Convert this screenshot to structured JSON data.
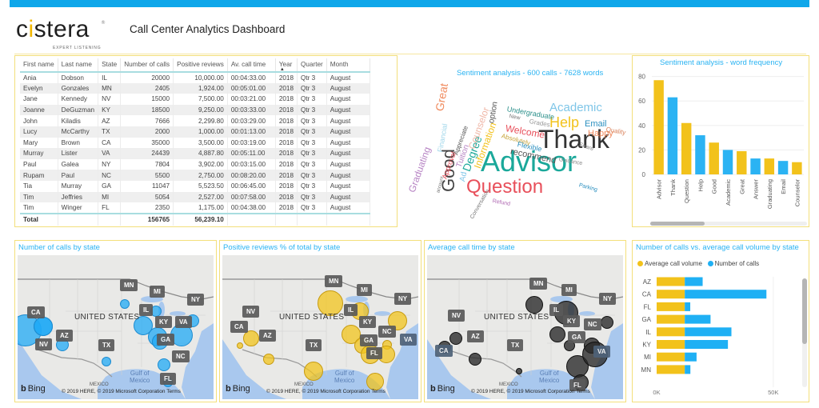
{
  "header": {
    "logo_text": "cistera",
    "logo_tagline": "EXPERT LISTENING",
    "logo_reg": "®",
    "title": "Call Center Analytics Dashboard"
  },
  "colors": {
    "accent_blue": "#0fa7ea",
    "bar_yellow": "#f2c21b",
    "bar_blue": "#2bb3f3",
    "panel_border": "#f3df7b",
    "title_blue": "#2ab3f2"
  },
  "table": {
    "columns": [
      "First name",
      "Last name",
      "State",
      "Number of calls",
      "Positive reviews",
      "Av. call time",
      "Year",
      "Quarter",
      "Month"
    ],
    "sorted_column": "Year",
    "sort_indicator": "▲",
    "rows": [
      [
        "Ania",
        "Dobson",
        "IL",
        "20000",
        "10,000.00",
        "00:04:33.00",
        "2018",
        "Qtr 3",
        "August"
      ],
      [
        "Evelyn",
        "Gonzales",
        "MN",
        "2405",
        "1,924.00",
        "00:05:01.00",
        "2018",
        "Qtr 3",
        "August"
      ],
      [
        "Jane",
        "Kennedy",
        "NV",
        "15000",
        "7,500.00",
        "00:03:21.00",
        "2018",
        "Qtr 3",
        "August"
      ],
      [
        "Joanne",
        "DeGuzman",
        "KY",
        "18500",
        "9,250.00",
        "00:03:33.00",
        "2018",
        "Qtr 3",
        "August"
      ],
      [
        "John",
        "Kiladis",
        "AZ",
        "7666",
        "2,299.80",
        "00:03:29.00",
        "2018",
        "Qtr 3",
        "August"
      ],
      [
        "Lucy",
        "McCarthy",
        "TX",
        "2000",
        "1,000.00",
        "00:01:13.00",
        "2018",
        "Qtr 3",
        "August"
      ],
      [
        "Mary",
        "Brown",
        "CA",
        "35000",
        "3,500.00",
        "00:03:19.00",
        "2018",
        "Qtr 3",
        "August"
      ],
      [
        "Murray",
        "Lister",
        "VA",
        "24439",
        "4,887.80",
        "00:05:11.00",
        "2018",
        "Qtr 3",
        "August"
      ],
      [
        "Paul",
        "Galea",
        "NY",
        "7804",
        "3,902.00",
        "00:03:15.00",
        "2018",
        "Qtr 3",
        "August"
      ],
      [
        "Rupam",
        "Paul",
        "NC",
        "5500",
        "2,750.00",
        "00:08:20.00",
        "2018",
        "Qtr 3",
        "August"
      ],
      [
        "Tia",
        "Murray",
        "GA",
        "11047",
        "5,523.50",
        "00:06:45.00",
        "2018",
        "Qtr 3",
        "August"
      ],
      [
        "Tim",
        "Jeffries",
        "MI",
        "5054",
        "2,527.00",
        "00:07:58.00",
        "2018",
        "Qtr 3",
        "August"
      ],
      [
        "Tim",
        "Winger",
        "FL",
        "2350",
        "1,175.00",
        "00:04:38.00",
        "2018",
        "Qtr 3",
        "August"
      ]
    ],
    "total": [
      "Total",
      "",
      "",
      "156765",
      "56,239.10",
      "",
      "",
      "",
      ""
    ]
  },
  "wordcloud": {
    "title": "Sentiment analysis - 600 calls - 7628 words",
    "words": [
      {
        "text": "Advisor",
        "color": "#1aa89a"
      },
      {
        "text": "Thank",
        "color": "#333333"
      },
      {
        "text": "Question",
        "color": "#e8505b"
      },
      {
        "text": "Help",
        "color": "#f2c21b"
      },
      {
        "text": "Academic",
        "color": "#7fc6e8"
      },
      {
        "text": "Good",
        "color": "#444444"
      },
      {
        "text": "Great",
        "color": "#f08a5d"
      },
      {
        "text": "Graduating",
        "color": "#b784c4"
      },
      {
        "text": "Email",
        "color": "#2a8fbf"
      },
      {
        "text": "Happy",
        "color": "#f08a5d"
      },
      {
        "text": "Quality",
        "color": "#d9825b"
      },
      {
        "text": "Welcome",
        "color": "#e8505b"
      },
      {
        "text": "Undergraduate",
        "color": "#2a8f8a"
      },
      {
        "text": "Grades",
        "color": "#999999"
      },
      {
        "text": "New",
        "color": "#777777"
      },
      {
        "text": "Absolutely",
        "color": "#c7a43a"
      },
      {
        "text": "Flexible",
        "color": "#2a8fbf"
      },
      {
        "text": "recommend",
        "color": "#555555"
      },
      {
        "text": "Guidance",
        "color": "#888888"
      },
      {
        "text": "Share",
        "color": "#888888"
      },
      {
        "text": "Parking",
        "color": "#2a8fbf"
      },
      {
        "text": "Refund",
        "color": "#b06ab3"
      },
      {
        "text": "Conversation",
        "color": "#777777"
      },
      {
        "text": "account",
        "color": "#777777"
      },
      {
        "text": "Ad",
        "color": "#7fc6e8"
      },
      {
        "text": "Degree",
        "color": "#1aa89a"
      },
      {
        "text": "Information",
        "color": "#f2c21b"
      },
      {
        "text": "Counselor",
        "color": "#f0b8a8"
      },
      {
        "text": "option",
        "color": "#555555"
      },
      {
        "text": "Tuition",
        "color": "#b784c4"
      },
      {
        "text": "Approval",
        "color": "#e8505b"
      },
      {
        "text": "Appreciate",
        "color": "#555555"
      },
      {
        "text": "Financial",
        "color": "#9fd6ea"
      }
    ]
  },
  "word_frequency": {
    "title": "Sentiment analysis - word frequency"
  },
  "maps": [
    {
      "title": "Number of calls by state",
      "style": "blue",
      "labels": [
        "MN",
        "MI",
        "NY",
        "IL",
        "CA",
        "KY",
        "VA",
        "AZ",
        "NV",
        "GA",
        "TX",
        "NC",
        "FL"
      ]
    },
    {
      "title": "Positive reviews % of total by state",
      "style": "yellow",
      "labels": [
        "MN",
        "MI",
        "NY",
        "NV",
        "IL",
        "CA",
        "KY",
        "AZ",
        "NC",
        "VA",
        "GA",
        "TX",
        "FL"
      ]
    },
    {
      "title": "Average call time by state",
      "style": "dark",
      "labels": [
        "MN",
        "MI",
        "NY",
        "NV",
        "IL",
        "KY",
        "NC",
        "AZ",
        "GA",
        "TX",
        "CA",
        "VA",
        "FL"
      ]
    }
  ],
  "map_common": {
    "country_label": "UNITED STATES",
    "gulf_label_1": "Gulf of",
    "gulf_label_2": "Mexico",
    "mexico_label": "MEXICO",
    "bing_label": "Bing",
    "copyright": "© 2019 HERE, © 2019 Microsoft Corporation  Terms"
  },
  "stacked": {
    "title": "Number of calls vs. average call volume by state",
    "legend": [
      {
        "label": "Average call volume",
        "color": "#f2c21b"
      },
      {
        "label": "Number of calls",
        "color": "#1fb0f4"
      }
    ]
  },
  "chart_data": [
    {
      "type": "bar",
      "title": "Sentiment analysis - word frequency",
      "categories": [
        "Advisor",
        "Thank",
        "Question",
        "Help",
        "Good",
        "Academic",
        "Great",
        "Answer",
        "Graduating",
        "Email",
        "Counselor"
      ],
      "values": [
        77,
        63,
        42,
        32,
        26,
        20,
        19,
        13,
        13,
        11,
        10
      ],
      "colors": [
        "#f2c21b",
        "#2bb3f3",
        "#f2c21b",
        "#2bb3f3",
        "#f2c21b",
        "#2bb3f3",
        "#f2c21b",
        "#2bb3f3",
        "#f2c21b",
        "#2bb3f3",
        "#f2c21b"
      ],
      "xlabel": "",
      "ylabel": "",
      "ylim": [
        0,
        85
      ],
      "yticks": [
        0,
        20,
        40,
        60,
        80
      ],
      "grid": true
    },
    {
      "type": "bar",
      "orientation": "horizontal-stacked",
      "title": "Number of calls vs. average call volume by state",
      "categories": [
        "AZ",
        "CA",
        "FL",
        "GA",
        "IL",
        "KY",
        "MI",
        "MN"
      ],
      "series": [
        {
          "name": "Average call volume",
          "values": [
            12059,
            12059,
            12059,
            12059,
            12059,
            12059,
            12059,
            12059
          ]
        },
        {
          "name": "Number of calls",
          "values": [
            7666,
            35000,
            2350,
            11047,
            20000,
            18500,
            5054,
            2405
          ]
        }
      ],
      "xlim": [
        0,
        60000
      ],
      "xticks": [
        "0K",
        "50K"
      ],
      "legend": "top-left",
      "grid": true
    },
    {
      "type": "scatter",
      "title": "Number of calls by state",
      "categories": [
        "IL",
        "MN",
        "NV",
        "KY",
        "AZ",
        "TX",
        "CA",
        "VA",
        "NY",
        "NC",
        "GA",
        "MI",
        "FL"
      ],
      "values": [
        20000,
        2405,
        15000,
        18500,
        7666,
        2000,
        35000,
        24439,
        7804,
        5500,
        11047,
        5054,
        2350
      ]
    },
    {
      "type": "scatter",
      "title": "Positive reviews % of total by state",
      "categories": [
        "IL",
        "MN",
        "NV",
        "KY",
        "AZ",
        "TX",
        "CA",
        "VA",
        "NY",
        "NC",
        "GA",
        "MI",
        "FL"
      ],
      "values": [
        10000,
        1924,
        7500,
        9250,
        2299.8,
        1000,
        3500,
        4887.8,
        3902,
        2750,
        5523.5,
        2527,
        1175
      ]
    },
    {
      "type": "scatter",
      "title": "Average call time by state",
      "categories": [
        "IL",
        "MN",
        "NV",
        "KY",
        "AZ",
        "TX",
        "CA",
        "VA",
        "NY",
        "NC",
        "GA",
        "MI",
        "FL"
      ],
      "values": [
        "00:04:33",
        "00:05:01",
        "00:03:21",
        "00:03:33",
        "00:03:29",
        "00:01:13",
        "00:03:19",
        "00:05:11",
        "00:03:15",
        "00:08:20",
        "00:06:45",
        "00:07:58",
        "00:04:38"
      ]
    }
  ]
}
